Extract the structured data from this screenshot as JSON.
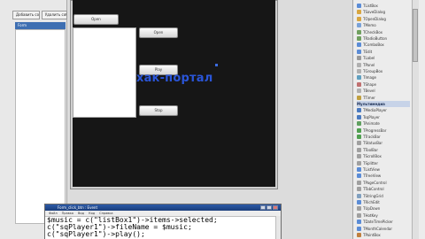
{
  "watermark_text": "хак-портал",
  "left_panel": {
    "toolbar": [
      {
        "label": "Добавить событие"
      },
      {
        "label": "Удалить событие"
      }
    ],
    "list_header": "Form",
    "list_items": []
  },
  "form": {
    "buttons": [
      {
        "label": "Open"
      },
      {
        "label": "Open"
      },
      {
        "label": "Play"
      },
      {
        "label": "Stop"
      }
    ]
  },
  "properties": {
    "rows": [
      {
        "label": "TListBox",
        "icon": "listbox-icon",
        "color": "#5b8cd6"
      },
      {
        "label": "TSaveDialog",
        "icon": "dialog-icon",
        "color": "#d8a640"
      },
      {
        "label": "TOpenDialog",
        "icon": "dialog-icon",
        "color": "#d8a640"
      },
      {
        "label": "TMemo",
        "icon": "memo-icon",
        "color": "#7aa2d8"
      },
      {
        "label": "TCheckBox",
        "icon": "checkbox-icon",
        "color": "#70a060"
      },
      {
        "label": "TRadioButton",
        "icon": "radio-icon",
        "color": "#70a060"
      },
      {
        "label": "TComboBox",
        "icon": "combobox-icon",
        "color": "#5b8cd6"
      },
      {
        "label": "TEdit",
        "icon": "edit-icon",
        "color": "#5b8cd6"
      },
      {
        "label": "TLabel",
        "icon": "label-icon",
        "color": "#999999"
      },
      {
        "label": "TPanel",
        "icon": "panel-icon",
        "color": "#b0b0b0"
      },
      {
        "label": "TGroupBox",
        "icon": "groupbox-icon",
        "color": "#b0b0b0"
      },
      {
        "label": "TImage",
        "icon": "image-icon",
        "color": "#60a0c0"
      },
      {
        "label": "TShape",
        "icon": "shape-icon",
        "color": "#c07070"
      },
      {
        "label": "TBevel",
        "icon": "bevel-icon",
        "color": "#b0b0b0"
      },
      {
        "label": "TTimer",
        "icon": "timer-icon",
        "color": "#c0a040"
      },
      {
        "label": "Мультимедиа",
        "group": true
      },
      {
        "label": "TMediaPlayer",
        "icon": "player-icon",
        "color": "#4a7ac0"
      },
      {
        "label": "TsqPlayer",
        "icon": "player-icon",
        "color": "#4a7ac0"
      },
      {
        "label": "TAnimate",
        "icon": "animate-icon",
        "color": "#60a060"
      },
      {
        "label": "TProgressBar",
        "icon": "progress-icon",
        "color": "#50a050"
      },
      {
        "label": "TTrackBar",
        "icon": "trackbar-icon",
        "color": "#50a050"
      },
      {
        "label": "TStatusBar",
        "icon": "statusbar-icon",
        "color": "#a0a0a0"
      },
      {
        "label": "TToolBar",
        "icon": "toolbar-icon",
        "color": "#a0a0a0"
      },
      {
        "label": "TScrollBox",
        "icon": "scrollbox-icon",
        "color": "#a0a0a0"
      },
      {
        "label": "TSplitter",
        "icon": "splitter-icon",
        "color": "#a0a0a0"
      },
      {
        "label": "TListView",
        "icon": "listview-icon",
        "color": "#5b8cd6"
      },
      {
        "label": "TTreeView",
        "icon": "treeview-icon",
        "color": "#5b8cd6"
      },
      {
        "label": "TPageControl",
        "icon": "pagecontrol-icon",
        "color": "#a0a0a0"
      },
      {
        "label": "TTabControl",
        "icon": "tabcontrol-icon",
        "color": "#a0a0a0"
      },
      {
        "label": "TStringGrid",
        "icon": "grid-icon",
        "color": "#80a0c0"
      },
      {
        "label": "TRichEdit",
        "icon": "richedit-icon",
        "color": "#5b8cd6"
      },
      {
        "label": "TUpDown",
        "icon": "updown-icon",
        "color": "#a0a0a0"
      },
      {
        "label": "THotKey",
        "icon": "hotkey-icon",
        "color": "#a0a0a0"
      },
      {
        "label": "TDateTimePicker",
        "icon": "datetime-icon",
        "color": "#5b8cd6"
      },
      {
        "label": "TMonthCalendar",
        "icon": "calendar-icon",
        "color": "#5b8cd6"
      },
      {
        "label": "TPaintBox",
        "icon": "paintbox-icon",
        "color": "#c08040"
      }
    ]
  },
  "code_editor": {
    "title": "Form_click_btn : Event",
    "menu": [
      "Файл",
      "Правка",
      "Вид",
      "Код",
      "Справка"
    ],
    "lines": [
      "$music = c(\"listBox1\")->items->selected;",
      "c(\"sqPlayer1\")->fileName = $music;",
      "c(\"sqPlayer1\")->play();"
    ]
  }
}
